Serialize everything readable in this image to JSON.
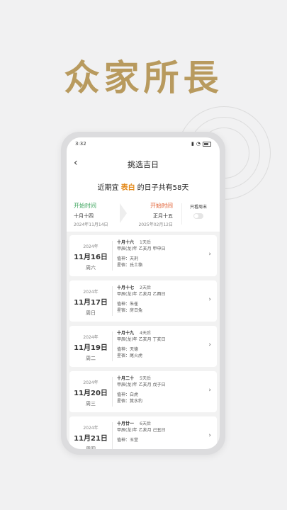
{
  "headline": "众家所長",
  "status": {
    "time": "3:32"
  },
  "header": {
    "back_icon": "chevron-left-icon",
    "title": "挑选吉日"
  },
  "summary": {
    "prefix": "近期宜",
    "highlight": "表白",
    "suffix": "的日子共有58天"
  },
  "range": {
    "start": {
      "label": "开始时间",
      "lunar": "十月十四",
      "date": "2024年11月14日"
    },
    "end": {
      "label": "开始时间",
      "lunar": "正月十五",
      "date": "2025年02月12日"
    },
    "weekend_label": "只看周末"
  },
  "colors": {
    "accent": "#e48a1b",
    "start_green": "#3aa35b",
    "end_red": "#e05a2c",
    "headline_gold": "#b89a5e"
  },
  "days": [
    {
      "year": "2024年",
      "md": "11月16日",
      "week": "周六",
      "lunar": "十月十六",
      "later": "1天后",
      "gz": "甲辰(龙)年  乙亥月  甲申日",
      "god": "值神：天刑",
      "star": "星宿：氐土貉"
    },
    {
      "year": "2024年",
      "md": "11月17日",
      "week": "周日",
      "lunar": "十月十七",
      "later": "2天后",
      "gz": "甲辰(龙)年  乙亥月  乙酉日",
      "god": "值神：朱雀",
      "star": "星宿：房日兔"
    },
    {
      "year": "2024年",
      "md": "11月19日",
      "week": "周二",
      "lunar": "十月十九",
      "later": "4天后",
      "gz": "甲辰(龙)年  乙亥月  丁亥日",
      "god": "值神：天德",
      "star": "星宿：尾火虎"
    },
    {
      "year": "2024年",
      "md": "11月20日",
      "week": "周三",
      "lunar": "十月二十",
      "later": "5天后",
      "gz": "甲辰(龙)年  乙亥月  戊子日",
      "god": "值神：白虎",
      "star": "星宿：箕水豹"
    },
    {
      "year": "2024年",
      "md": "11月21日",
      "week": "周四",
      "lunar": "十月廿一",
      "later": "6天后",
      "gz": "甲辰(龙)年  乙亥月  己丑日",
      "god": "值神：玉堂",
      "star": ""
    }
  ]
}
